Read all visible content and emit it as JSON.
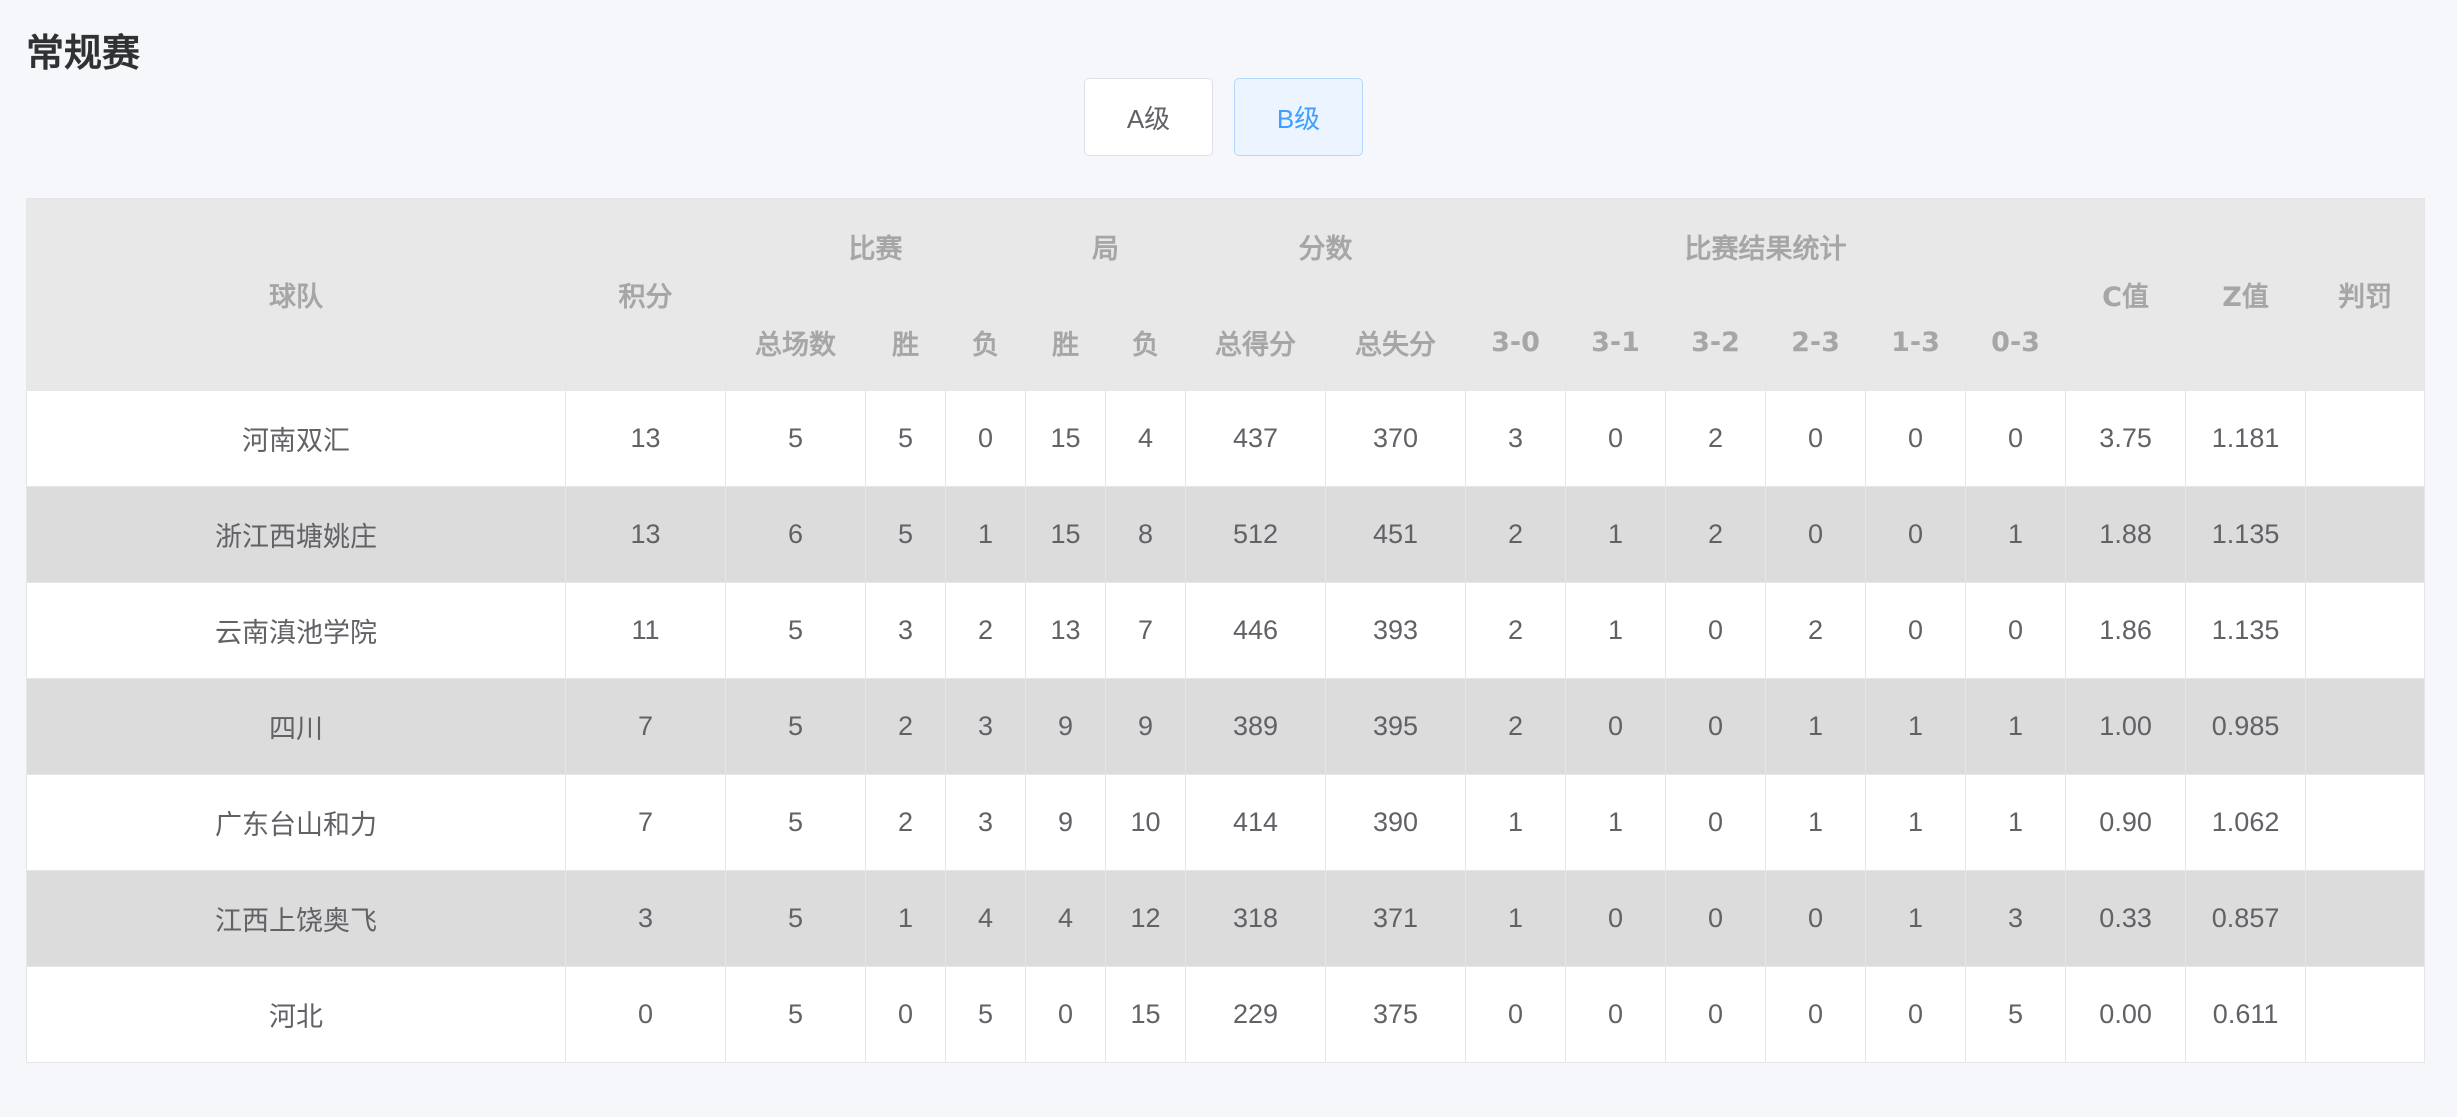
{
  "page": {
    "title": "常规赛"
  },
  "tabs": [
    {
      "label": "A级",
      "active": false
    },
    {
      "label": "B级",
      "active": true
    }
  ],
  "table": {
    "headers": {
      "team": "球队",
      "points": "积分",
      "matches": "比赛",
      "games": "局",
      "score": "分数",
      "result_stats": "比赛结果统计",
      "c_value": "C值",
      "z_value": "Z值",
      "penalty": "判罚",
      "matches_total": "总场数",
      "matches_won": "胜",
      "matches_lost": "负",
      "games_won": "胜",
      "games_lost": "负",
      "points_for": "总得分",
      "points_against": "总失分",
      "r30": "3-0",
      "r31": "3-1",
      "r32": "3-2",
      "r23": "2-3",
      "r13": "1-3",
      "r03": "0-3"
    },
    "rows": [
      {
        "team": "河南双汇",
        "points": "13",
        "played": "5",
        "won": "5",
        "lost": "0",
        "games_won": "15",
        "games_lost": "4",
        "pf": "437",
        "pa": "370",
        "r30": "3",
        "r31": "0",
        "r32": "2",
        "r23": "0",
        "r13": "0",
        "r03": "0",
        "c": "3.75",
        "z": "1.181",
        "penalty": ""
      },
      {
        "team": "浙江西塘姚庄",
        "points": "13",
        "played": "6",
        "won": "5",
        "lost": "1",
        "games_won": "15",
        "games_lost": "8",
        "pf": "512",
        "pa": "451",
        "r30": "2",
        "r31": "1",
        "r32": "2",
        "r23": "0",
        "r13": "0",
        "r03": "1",
        "c": "1.88",
        "z": "1.135",
        "penalty": ""
      },
      {
        "team": "云南滇池学院",
        "points": "11",
        "played": "5",
        "won": "3",
        "lost": "2",
        "games_won": "13",
        "games_lost": "7",
        "pf": "446",
        "pa": "393",
        "r30": "2",
        "r31": "1",
        "r32": "0",
        "r23": "2",
        "r13": "0",
        "r03": "0",
        "c": "1.86",
        "z": "1.135",
        "penalty": ""
      },
      {
        "team": "四川",
        "points": "7",
        "played": "5",
        "won": "2",
        "lost": "3",
        "games_won": "9",
        "games_lost": "9",
        "pf": "389",
        "pa": "395",
        "r30": "2",
        "r31": "0",
        "r32": "0",
        "r23": "1",
        "r13": "1",
        "r03": "1",
        "c": "1.00",
        "z": "0.985",
        "penalty": ""
      },
      {
        "team": "广东台山和力",
        "points": "7",
        "played": "5",
        "won": "2",
        "lost": "3",
        "games_won": "9",
        "games_lost": "10",
        "pf": "414",
        "pa": "390",
        "r30": "1",
        "r31": "1",
        "r32": "0",
        "r23": "1",
        "r13": "1",
        "r03": "1",
        "c": "0.90",
        "z": "1.062",
        "penalty": ""
      },
      {
        "team": "江西上饶奥飞",
        "points": "3",
        "played": "5",
        "won": "1",
        "lost": "4",
        "games_won": "4",
        "games_lost": "12",
        "pf": "318",
        "pa": "371",
        "r30": "1",
        "r31": "0",
        "r32": "0",
        "r23": "0",
        "r13": "1",
        "r03": "3",
        "c": "0.33",
        "z": "0.857",
        "penalty": ""
      },
      {
        "team": "河北",
        "points": "0",
        "played": "5",
        "won": "0",
        "lost": "5",
        "games_won": "0",
        "games_lost": "15",
        "pf": "229",
        "pa": "375",
        "r30": "0",
        "r31": "0",
        "r32": "0",
        "r23": "0",
        "r13": "0",
        "r03": "5",
        "c": "0.00",
        "z": "0.611",
        "penalty": ""
      }
    ]
  }
}
